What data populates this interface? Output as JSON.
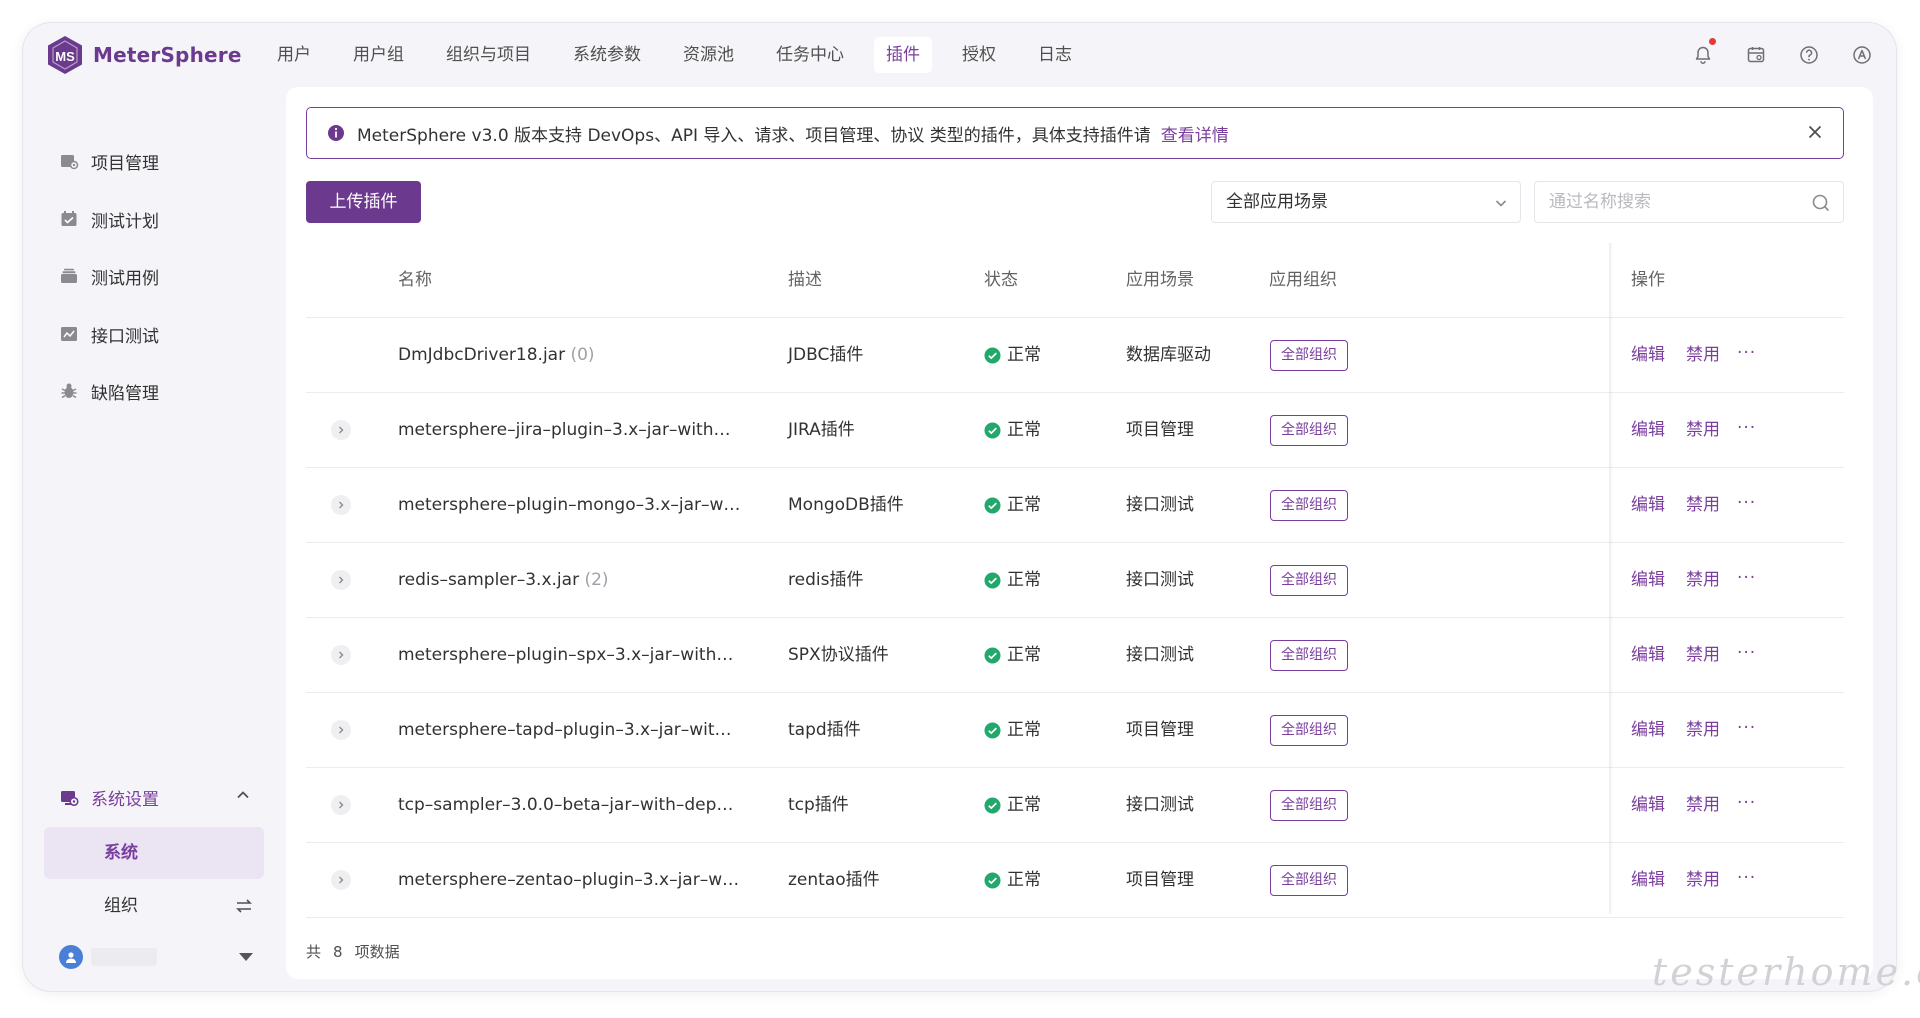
{
  "app": {
    "name": "MeterSphere",
    "logo_letters": "MS"
  },
  "nav": {
    "items": [
      {
        "label": "用户",
        "active": false
      },
      {
        "label": "用户组",
        "active": false
      },
      {
        "label": "组织与项目",
        "active": false
      },
      {
        "label": "系统参数",
        "active": false
      },
      {
        "label": "资源池",
        "active": false
      },
      {
        "label": "任务中心",
        "active": false
      },
      {
        "label": "插件",
        "active": true
      },
      {
        "label": "授权",
        "active": false
      },
      {
        "label": "日志",
        "active": false
      }
    ],
    "icons": [
      "bell-icon",
      "calendar-icon",
      "help-icon",
      "language-icon"
    ]
  },
  "sidebar": {
    "items": [
      {
        "label": "项目管理",
        "icon": "project-icon"
      },
      {
        "label": "测试计划",
        "icon": "test-plan-icon"
      },
      {
        "label": "测试用例",
        "icon": "test-case-icon"
      },
      {
        "label": "接口测试",
        "icon": "api-test-icon"
      },
      {
        "label": "缺陷管理",
        "icon": "bug-icon"
      }
    ],
    "settings": {
      "label": "系统设置",
      "sub_active": "系统",
      "sub_other": "组织"
    }
  },
  "alert": {
    "text": "MeterSphere v3.0 版本支持 DevOps、API 导入、请求、项目管理、协议 类型的插件，具体支持插件请",
    "link": "查看详情"
  },
  "toolbar": {
    "upload_label": "上传插件",
    "scene_value": "全部应用场景",
    "search_placeholder": "通过名称搜索"
  },
  "table": {
    "headers": {
      "name": "名称",
      "desc": "描述",
      "status": "状态",
      "scene": "应用场景",
      "org": "应用组织",
      "ops": "操作"
    },
    "rows": [
      {
        "name": "DmJdbcDriver18.jar",
        "count": "(0)",
        "desc": "JDBC插件",
        "status": "正常",
        "scene": "数据库驱动",
        "org": "全部组织",
        "expandable": false
      },
      {
        "name": "metersphere–jira–plugin–3.x–jar–with…",
        "count": "",
        "desc": "JIRA插件",
        "status": "正常",
        "scene": "项目管理",
        "org": "全部组织",
        "expandable": true
      },
      {
        "name": "metersphere–plugin–mongo–3.x–jar–w…",
        "count": "",
        "desc": "MongoDB插件",
        "status": "正常",
        "scene": "接口测试",
        "org": "全部组织",
        "expandable": true
      },
      {
        "name": "redis–sampler–3.x.jar",
        "count": "(2)",
        "desc": "redis插件",
        "status": "正常",
        "scene": "接口测试",
        "org": "全部组织",
        "expandable": true
      },
      {
        "name": "metersphere–plugin–spx–3.x–jar–with…",
        "count": "",
        "desc": "SPX协议插件",
        "status": "正常",
        "scene": "接口测试",
        "org": "全部组织",
        "expandable": true
      },
      {
        "name": "metersphere–tapd–plugin–3.x–jar–wit…",
        "count": "",
        "desc": "tapd插件",
        "status": "正常",
        "scene": "项目管理",
        "org": "全部组织",
        "expandable": true
      },
      {
        "name": "tcp–sampler–3.0.0–beta–jar–with–dep…",
        "count": "",
        "desc": "tcp插件",
        "status": "正常",
        "scene": "接口测试",
        "org": "全部组织",
        "expandable": true
      },
      {
        "name": "metersphere–zentao–plugin–3.x–jar–w…",
        "count": "",
        "desc": "zentao插件",
        "status": "正常",
        "scene": "项目管理",
        "org": "全部组织",
        "expandable": true
      }
    ],
    "ops": {
      "edit": "编辑",
      "disable": "禁用",
      "more": "···"
    }
  },
  "footer": {
    "prefix": "共",
    "count": "8",
    "suffix": "项数据"
  },
  "watermark": "testerhome.com",
  "colors": {
    "accent": "#7a3f9e",
    "button": "#6b3a8f",
    "success": "#23a86b",
    "background": "#f5f4f8"
  }
}
